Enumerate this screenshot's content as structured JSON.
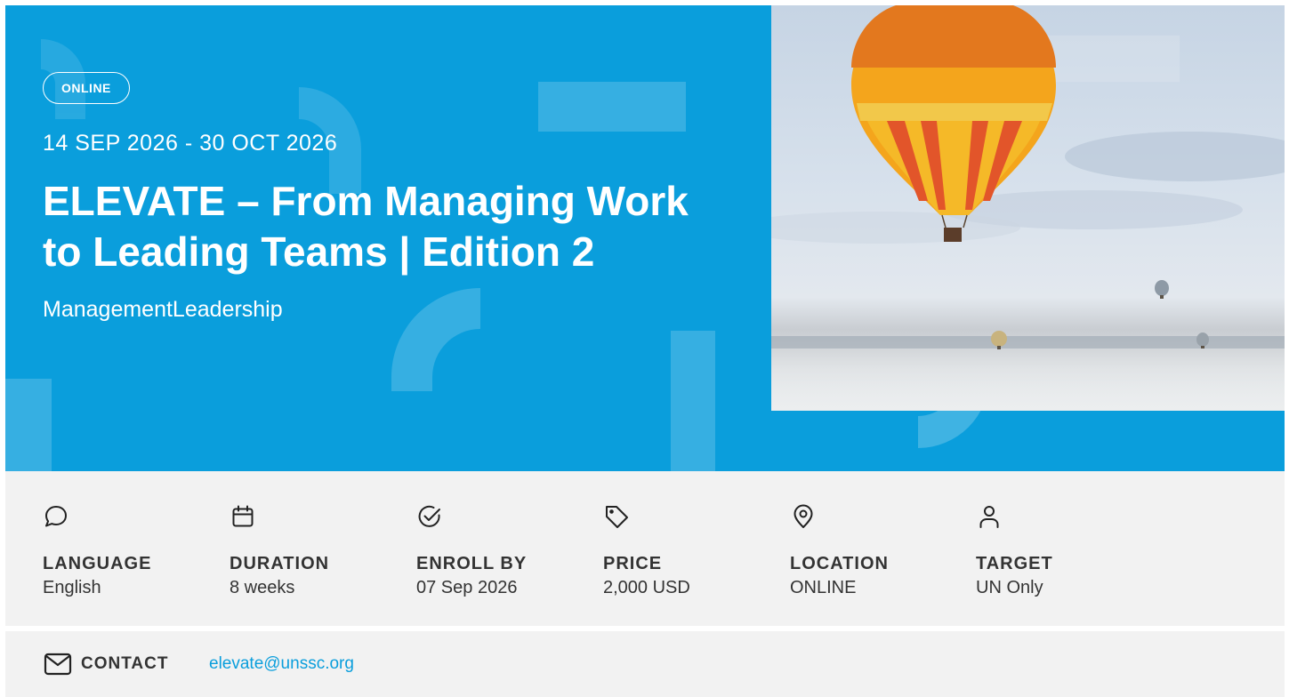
{
  "hero": {
    "delivery_badge": "ONLINE",
    "dates": "14 SEP 2026 - 30 OCT 2026",
    "title": "ELEVATE – From Managing Work to Leading Teams | Edition 2",
    "tags": "ManagementLeadership",
    "image": {
      "subject": "hot-air-balloons-over-misty-landscape"
    }
  },
  "details": [
    {
      "icon": "speech-bubble-icon",
      "label": "LANGUAGE",
      "value": "English"
    },
    {
      "icon": "calendar-icon",
      "label": "DURATION",
      "value": "8 weeks"
    },
    {
      "icon": "check-circle-icon",
      "label": "ENROLL BY",
      "value": "07 Sep 2026"
    },
    {
      "icon": "price-tag-icon",
      "label": "PRICE",
      "value": "2,000 USD"
    },
    {
      "icon": "location-pin-icon",
      "label": "LOCATION",
      "value": "ONLINE"
    },
    {
      "icon": "user-icon",
      "label": "TARGET",
      "value": "UN Only"
    }
  ],
  "contact": {
    "icon": "envelope-icon",
    "label": "CONTACT",
    "email": "elevate@unssc.org"
  },
  "colors": {
    "brand_blue": "#0a9edc",
    "panel_gray": "#f2f2f2",
    "text_dark": "#333333"
  }
}
